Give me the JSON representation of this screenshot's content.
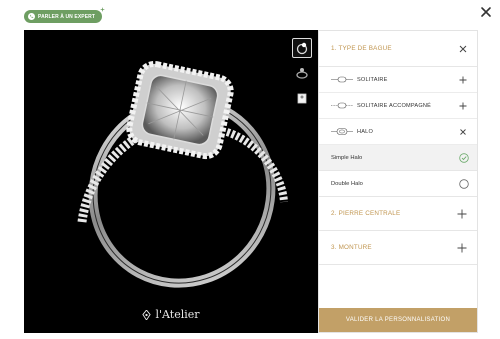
{
  "expert_button": {
    "label": "PARLER À UN EXPERT"
  },
  "viewer": {
    "brand": "l'Atelier",
    "thumbnails": [
      "ring-front-view",
      "ring-side-view",
      "ring-box-view"
    ]
  },
  "panel": {
    "section_type": {
      "label": "1. TYPE DE BAGUE",
      "options": [
        {
          "label": "SOLITAIRE",
          "action": "plus"
        },
        {
          "label": "SOLITAIRE ACCOMPAGNÉ",
          "action": "plus"
        },
        {
          "label": "HALO",
          "action": "close"
        }
      ],
      "halo_variants": [
        {
          "label": "Simple Halo",
          "selected": true
        },
        {
          "label": "Double Halo",
          "selected": false
        }
      ]
    },
    "section_stone": {
      "label": "2. PIERRE CENTRALE"
    },
    "section_mount": {
      "label": "3. MONTURE"
    },
    "validate_label": "VALIDER LA PERSONNALISATION"
  },
  "colors": {
    "accent_gold": "#c0954f",
    "button_gold": "#c2a067",
    "expert_green": "#6e9e62",
    "check_green": "#6aaa6a"
  }
}
